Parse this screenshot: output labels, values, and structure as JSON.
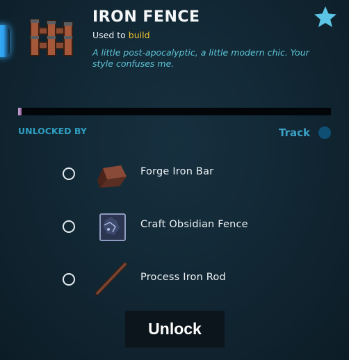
{
  "item": {
    "title": "IRON FENCE",
    "used_to_prefix": "Used to",
    "used_to_action": "build",
    "description": "A little post-apocalyptic, a little modern chic. Your style confuses me.",
    "icon": "iron-fence-icon"
  },
  "favorite": {
    "icon": "star-icon",
    "color": "#5cc4e4"
  },
  "progress": {
    "fraction": 0.01
  },
  "requirements": {
    "heading": "UNLOCKED BY",
    "track_label": "Track",
    "items": [
      {
        "label": "Forge Iron Bar",
        "icon": "iron-bar-icon",
        "completed": false
      },
      {
        "label": "Craft Obsidian Fence",
        "icon": "obsidian-fence-icon",
        "completed": false
      },
      {
        "label": "Process Iron Rod",
        "icon": "iron-rod-icon",
        "completed": false
      }
    ]
  },
  "actions": {
    "unlock_label": "Unlock"
  }
}
